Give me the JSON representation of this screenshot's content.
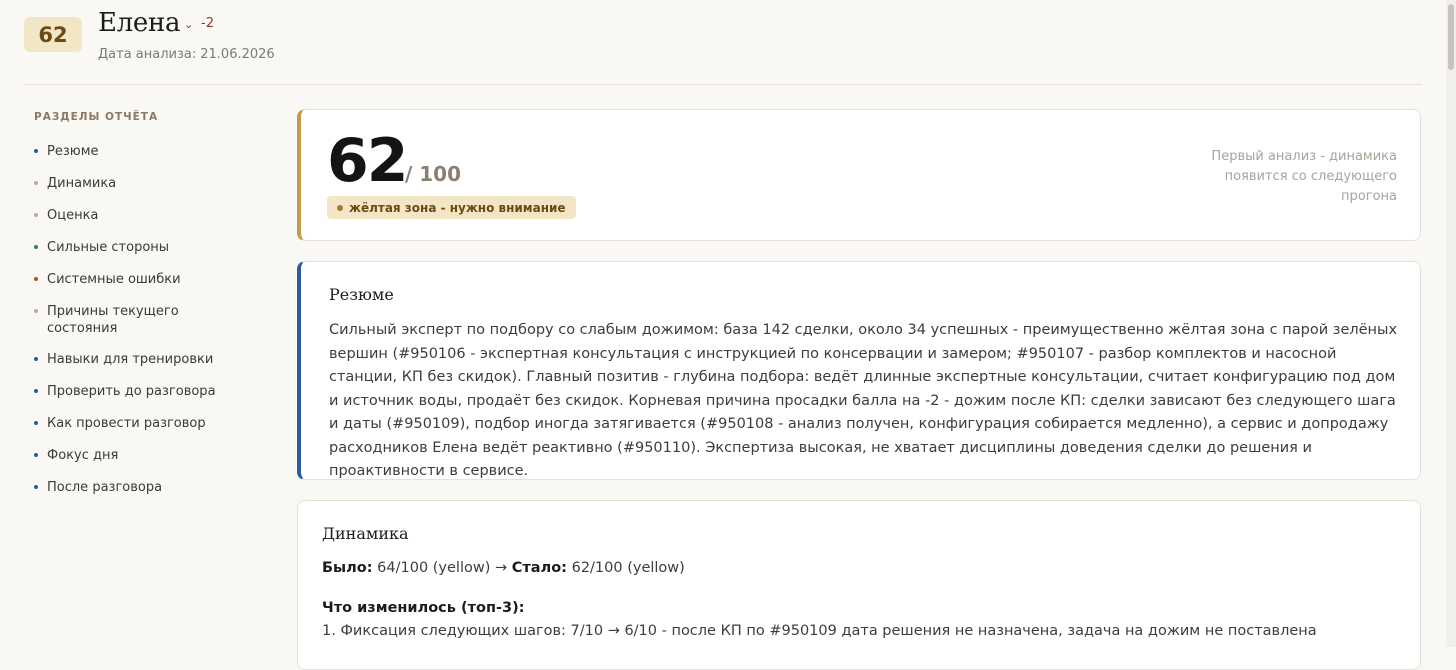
{
  "header": {
    "score": "62",
    "name": "Елена",
    "delta": "-2",
    "date_label": "Дата анализа:",
    "date_value": "21.06.2026"
  },
  "sidebar": {
    "title": "РАЗДЕЛЫ ОТЧЁТА",
    "items": [
      {
        "label": "Резюме",
        "dot_color": "#2b5c9e"
      },
      {
        "label": "Динамика",
        "dot_color": "#b8ad96"
      },
      {
        "label": "Оценка",
        "dot_color": "#b8ad96"
      },
      {
        "label": "Сильные стороны",
        "dot_color": "#3a7d5a"
      },
      {
        "label": "Системные ошибки",
        "dot_color": "#b84a3a"
      },
      {
        "label": "Причины текущего состояния",
        "dot_color": "#b8ad96"
      },
      {
        "label": "Навыки для тренировки",
        "dot_color": "#2b5c9e"
      },
      {
        "label": "Проверить до разговора",
        "dot_color": "#2b5c9e"
      },
      {
        "label": "Как провести разговор",
        "dot_color": "#2b5c9e"
      },
      {
        "label": "Фокус дня",
        "dot_color": "#2b5c9e"
      },
      {
        "label": "После разговора",
        "dot_color": "#2b5c9e"
      }
    ]
  },
  "score_card": {
    "score": "62",
    "out_of": "/ 100",
    "zone": "жёлтая зона - нужно внимание",
    "dynamics_note": "Первый анализ - динамика появится со следующего прогона"
  },
  "summary": {
    "title": "Резюме",
    "text": "Сильный эксперт по подбору со слабым дожимом: база 142 сделки, около 34 успешных - преимущественно жёлтая зона с парой зелёных вершин (#950106 - экспертная консультация с инструкцией по консервации и замером; #950107 - разбор комплектов и насосной станции, КП без скидок). Главный позитив - глубина подбора: ведёт длинные экспертные консультации, считает конфигурацию под дом и источник воды, продаёт без скидок. Корневая причина просадки балла на -2 - дожим после КП: сделки зависают без следующего шага и даты (#950109), подбор иногда затягивается (#950108 - анализ получен, конфигурация собирается медленно), а сервис и допродажу расходников Елена ведёт реактивно (#950110). Экспертиза высокая, не хватает дисциплины доведения сделки до решения и проактивности в сервисе."
  },
  "dynamics": {
    "title": "Динамика",
    "was_label": "Было:",
    "was_value": "64/100 (yellow)",
    "arrow": "→",
    "now_label": "Стало:",
    "now_value": "62/100 (yellow)",
    "changed_title": "Что изменилось (топ-3):",
    "change_1": "1. Фиксация следующих шагов: 7/10 → 6/10 - после КП по #950109 дата решения не назначена, задача на дожим не поставлена"
  },
  "colors": {
    "background": "#faf8f4",
    "accent_gold": "#c49a4e",
    "accent_blue": "#2b5c9e",
    "badge_bg": "#f3e6c7",
    "delta_red": "#8a3a2a"
  }
}
